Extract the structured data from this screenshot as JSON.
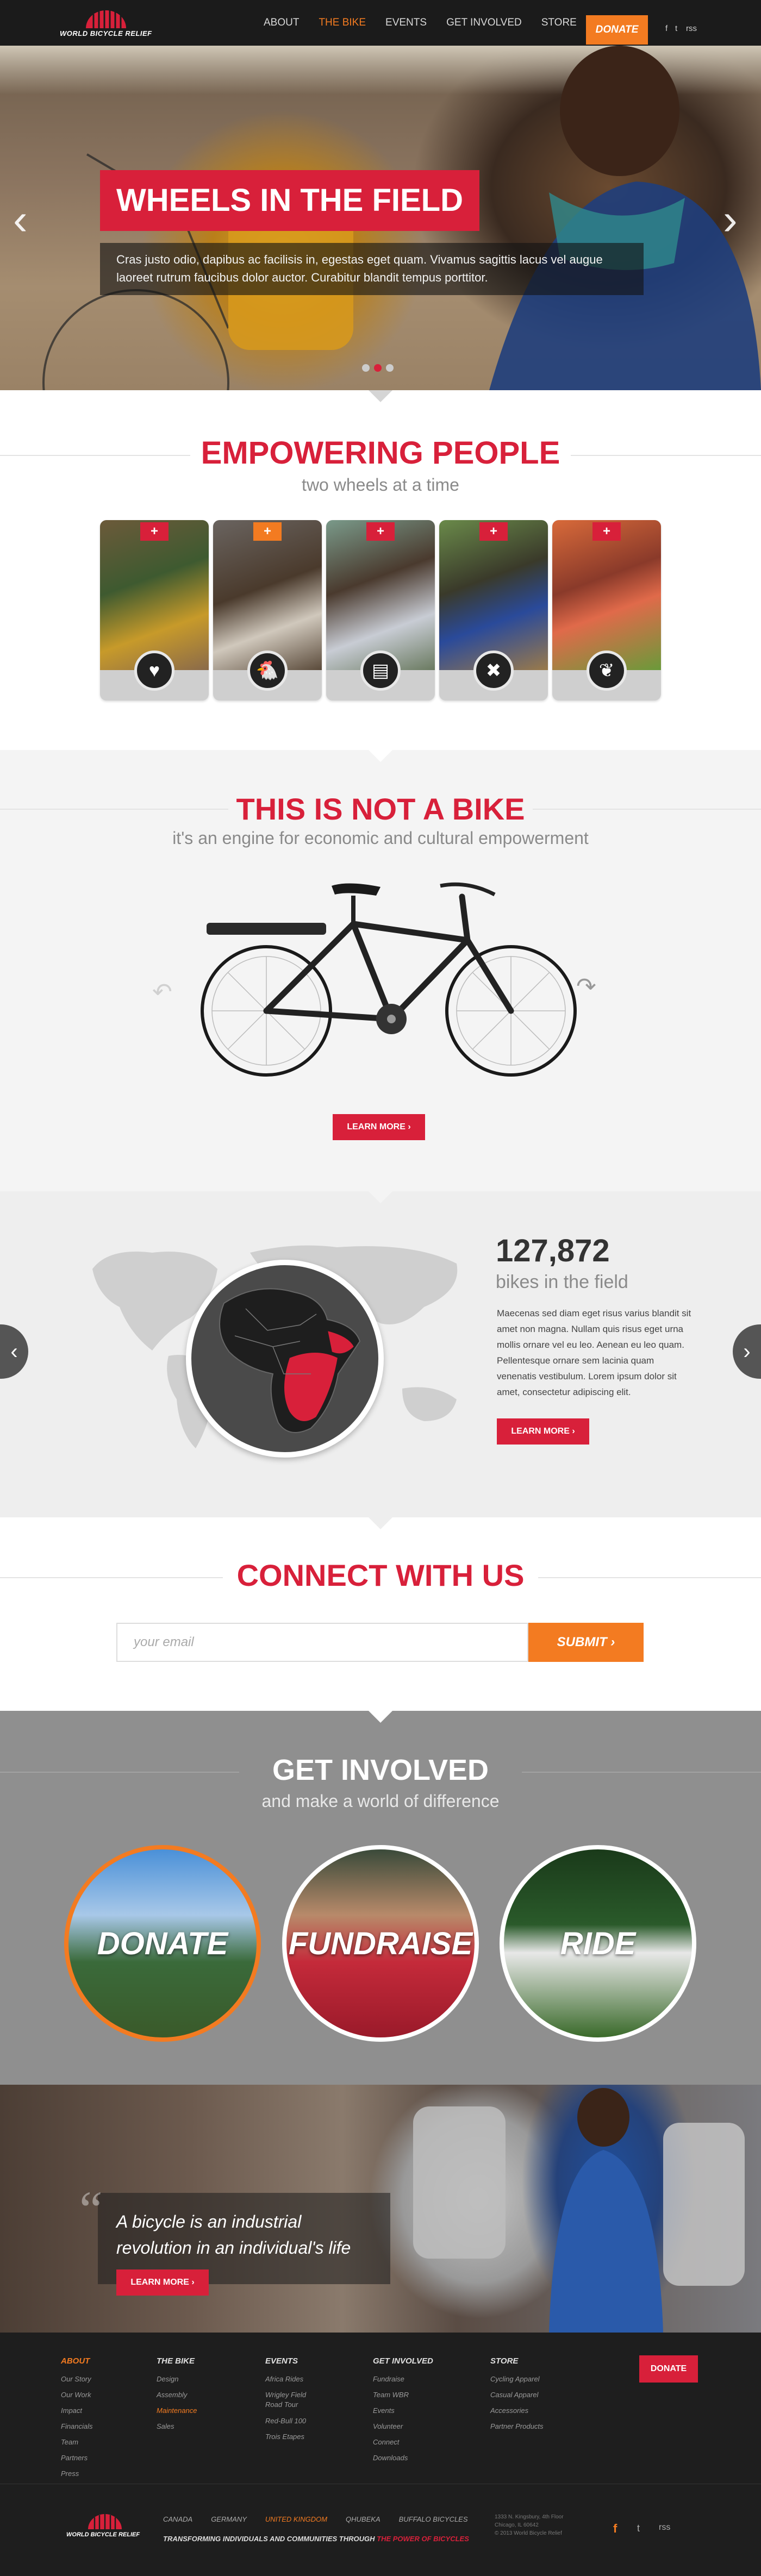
{
  "nav": {
    "logo_text": "WORLD BICYCLE RELIEF",
    "links": [
      "ABOUT",
      "THE BIKE",
      "EVENTS",
      "GET INVOLVED",
      "STORE"
    ],
    "active_link": "THE BIKE",
    "donate": "DONATE",
    "social": [
      "f",
      "t",
      "rss"
    ]
  },
  "hero": {
    "title": "WHEELS IN THE FIELD",
    "text": "Cras justo odio, dapibus ac facilisis in, egestas eget quam. Vivamus sagittis lacus vel augue laoreet rutrum faucibus dolor auctor. Curabitur blandit tempus porttitor.",
    "slides": 3,
    "active_slide": 2
  },
  "empowering": {
    "title": "EMPOWERING PEOPLE",
    "subtitle": "two wheels at a time",
    "cards": [
      {
        "icon": "heart-icon",
        "symbol": "♥",
        "color": "#d8203a"
      },
      {
        "icon": "chicken-icon",
        "symbol": "🐔",
        "color": "#f37b21"
      },
      {
        "icon": "book-icon",
        "symbol": "📖",
        "color": "#d8203a"
      },
      {
        "icon": "tools-icon",
        "symbol": "✖",
        "color": "#d8203a"
      },
      {
        "icon": "plant-icon",
        "symbol": "❦",
        "color": "#d8203a"
      }
    ]
  },
  "bike": {
    "title": "THIS IS NOT A BIKE",
    "subtitle": "it's an engine for economic and cultural empowerment",
    "button": "LEARN MORE ›"
  },
  "stats": {
    "number": "127,872",
    "label": "bikes in the field",
    "text": "Maecenas sed diam eget risus varius blandit sit amet non magna. Nullam quis risus eget urna mollis ornare vel eu leo. Aenean eu leo quam. Pellentesque ornare sem lacinia quam venenatis vestibulum. Lorem ipsum dolor sit amet, consectetur adipiscing elit.",
    "button": "LEARN MORE ›"
  },
  "connect": {
    "title": "CONNECT WITH US",
    "placeholder": "your email",
    "submit": "SUBMIT ›"
  },
  "get_involved": {
    "title": "GET INVOLVED",
    "subtitle": "and make a world of difference",
    "items": [
      "DONATE",
      "FUNDRAISE",
      "RIDE"
    ]
  },
  "quote": {
    "text": "A bicycle is an industrial revolution in an individual's life",
    "button": "LEARN MORE ›"
  },
  "footer": {
    "columns": [
      {
        "head": "ABOUT",
        "items": [
          "Our Story",
          "Our Work",
          "Impact",
          "Financials",
          "Team",
          "Partners",
          "Press"
        ]
      },
      {
        "head": "THE BIKE",
        "items": [
          "Design",
          "Assembly",
          "Maintenance",
          "Sales"
        ]
      },
      {
        "head": "EVENTS",
        "items": [
          "Africa Rides",
          "Wrigley Field Road Tour",
          "Red-Bull 100",
          "Trois Etapes"
        ]
      },
      {
        "head": "GET INVOLVED",
        "items": [
          "Fundraise",
          "Team WBR",
          "Events",
          "Volunteer",
          "Connect",
          "Downloads"
        ]
      },
      {
        "head": "STORE",
        "items": [
          "Cycling Apparel",
          "Casual Apparel",
          "Accessories",
          "Partner Products"
        ]
      }
    ],
    "active_head": "ABOUT",
    "active_item": "Maintenance",
    "donate": "DONATE",
    "logo_text": "WORLD BICYCLE RELIEF",
    "countries": [
      "CANADA",
      "GERMANY",
      "UNITED KINGDOM",
      "QHUBEKA",
      "BUFFALO BICYCLES"
    ],
    "active_country": "UNITED KINGDOM",
    "tagline_a": "TRANSFORMING INDIVIDUALS AND COMMUNITIES THROUGH",
    "tagline_b": "THE POWER OF BICYCLES",
    "address": "1333 N. Kingsbury, 4th Floor\nChicago, IL 60642\n© 2013 World Bicycle Relief",
    "social": [
      "f",
      "t",
      "rss"
    ]
  },
  "colors": {
    "brand_red": "#d8203a",
    "accent_orange": "#f37b21",
    "dark": "#1b1b1b"
  }
}
